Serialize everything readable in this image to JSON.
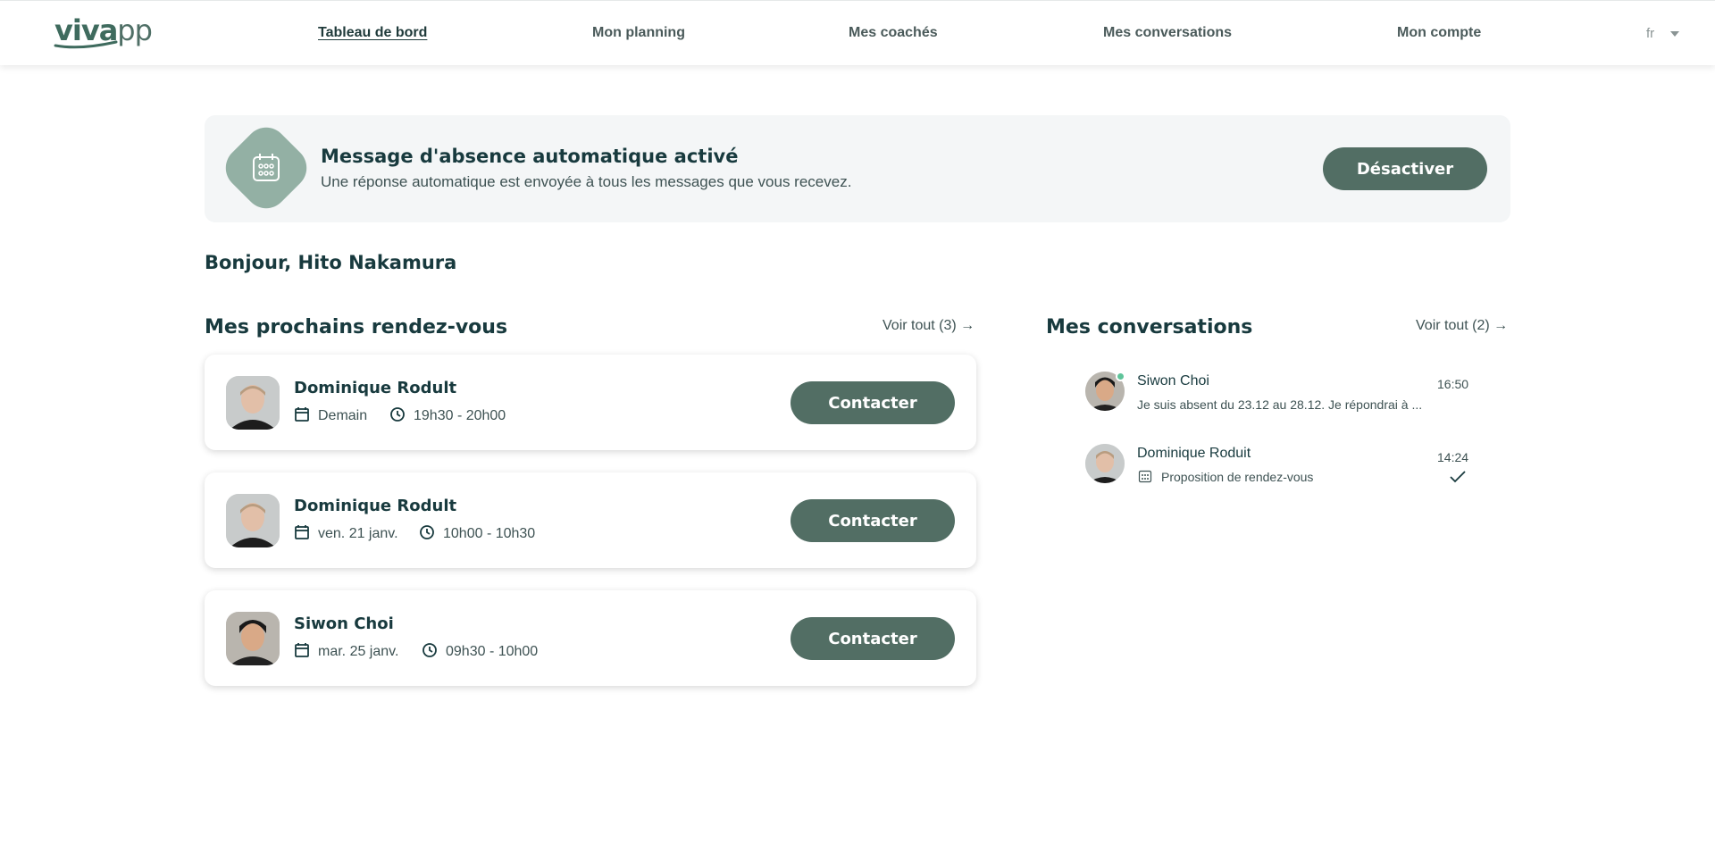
{
  "brand": {
    "logo_text_bold": "viva",
    "logo_text_light": "pp"
  },
  "nav": {
    "items": [
      {
        "label": "Tableau de bord",
        "active": true
      },
      {
        "label": "Mon planning",
        "active": false
      },
      {
        "label": "Mes coachés",
        "active": false
      },
      {
        "label": "Mes conversations",
        "active": false
      },
      {
        "label": "Mon compte",
        "active": false
      }
    ],
    "language": "fr"
  },
  "banner": {
    "icon": "calendar-away-icon",
    "title": "Message d'absence automatique activé",
    "subtitle": "Une réponse automatique est envoyée à tous les messages que vous recevez.",
    "button_label": "Désactiver"
  },
  "greeting": "Bonjour, Hito Nakamura",
  "appointments": {
    "title": "Mes prochains rendez-vous",
    "see_all": "Voir tout (3)",
    "items": [
      {
        "name": "Dominique Rodult",
        "date": "Demain",
        "time": "19h30 - 20h00",
        "button": "Contacter"
      },
      {
        "name": "Dominique Rodult",
        "date": "ven. 21 janv.",
        "time": "10h00 - 10h30",
        "button": "Contacter"
      },
      {
        "name": "Siwon Choi",
        "date": "mar. 25 janv.",
        "time": "09h30 - 10h00",
        "button": "Contacter"
      }
    ]
  },
  "conversations": {
    "title": "Mes conversations",
    "see_all": "Voir tout (2)",
    "items": [
      {
        "name": "Siwon Choi",
        "preview": "Je suis absent du 23.12 au 28.12. Je répondrai à ...",
        "time": "16:50",
        "online": true
      },
      {
        "name": "Dominique Roduit",
        "preview": "Proposition de rendez-vous",
        "time": "14:24",
        "read": true
      }
    ]
  },
  "colors": {
    "accent": "#526e64",
    "heading": "#183a3e",
    "banner_bg": "#f4f6f7",
    "icon_bg": "#93b0a4",
    "online": "#5fc49a"
  }
}
